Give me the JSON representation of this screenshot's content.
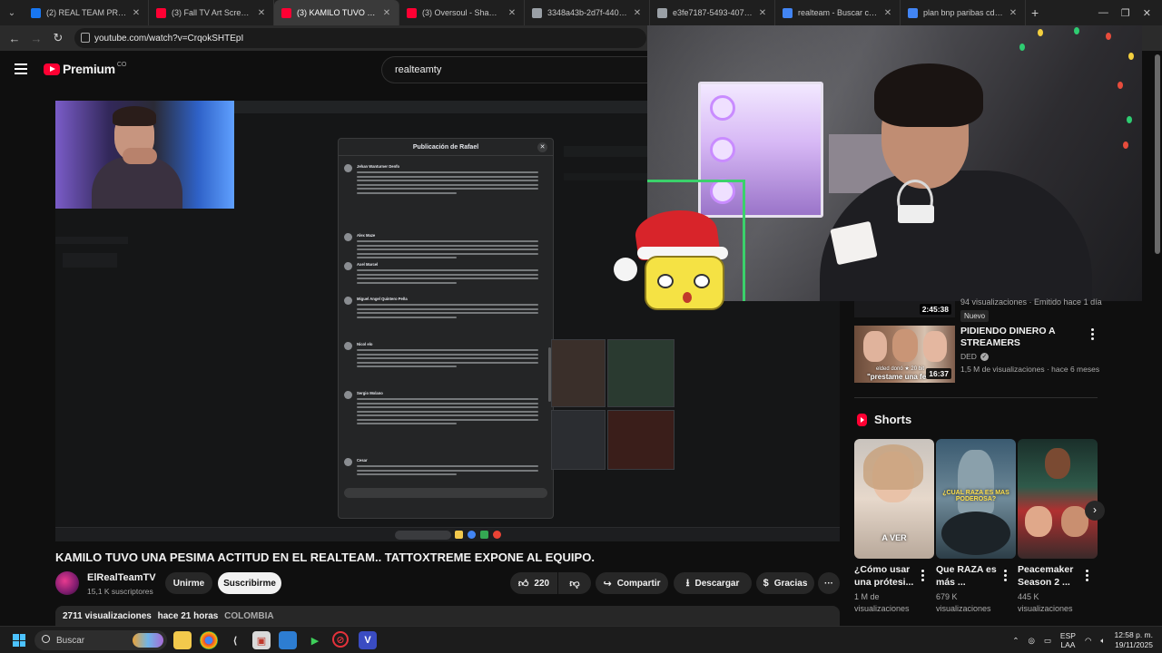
{
  "browser": {
    "tabs": [
      {
        "title": "(2) REAL TEAM PRRASI | F",
        "favicon_color": "#1877f2",
        "active": false
      },
      {
        "title": "(3) Fall TV Art Screensaver",
        "favicon_color": "#ff0033",
        "active": false
      },
      {
        "title": "(3) KAMILO TUVO UNA PE",
        "favicon_color": "#ff0033",
        "active": true
      },
      {
        "title": "(3) Oversoul - Shaman Ki",
        "favicon_color": "#ff0033",
        "active": false
      },
      {
        "title": "3348a43b-2d7f-440a-91b",
        "favicon_color": "#9aa0a6",
        "active": false
      },
      {
        "title": "e3fe7187-5493-4079-a6e",
        "favicon_color": "#9aa0a6",
        "active": false
      },
      {
        "title": "realteam - Buscar con Go",
        "favicon_color": "#4285f4",
        "active": false
      },
      {
        "title": "plan bnp paribas cdf - Bu",
        "favicon_color": "#4285f4",
        "active": false
      }
    ],
    "url": "youtube.com/watch?v=CrqokSHTEpI"
  },
  "youtube": {
    "logo_text": "Premium",
    "logo_sup": "CO",
    "search_query": "realteamty"
  },
  "video": {
    "title": "KAMILO TUVO UNA PESIMA ACTITUD EN EL REALTEAM.. TATTOXTREME EXPONE AL EQUIPO.",
    "channel_name": "ElRealTeamTV",
    "subscribers": "15,1 K suscriptores",
    "join_label": "Unirme",
    "subscribe_label": "Suscribirme",
    "likes": "220",
    "share_label": "Compartir",
    "download_label": "Descargar",
    "thanks_label": "Gracias",
    "views": "2711 visualizaciones",
    "published": "hace 21 horas",
    "hashtag": "COLOMBIA"
  },
  "embedded_screen": {
    "post_title": "Publicación de Rafael",
    "commenters": [
      "Jehan Wanturner Denfo",
      "Alex Maze",
      "Axel Marcel",
      "Miguel Angel Quintero Peña",
      "Nicol elo",
      "Sergio Molano",
      "Cesar"
    ]
  },
  "sidebar": {
    "top_item": {
      "duration": "2:45:38",
      "meta": "94 visualizaciones · Emitido hace 1 día",
      "badge": "Nuevo"
    },
    "recommended": {
      "title": "PIDIENDO DINERO A STREAMERS",
      "channel": "DED",
      "stats": "1,5 M de visualizaciones · hace 6 meses",
      "duration": "16:37",
      "thumb_caption": "\"prestame una fe",
      "thumb_caption_small": "elded donó ★ 20 bit"
    },
    "shorts_heading": "Shorts",
    "shorts": [
      {
        "title": "¿Cómo usar una prótesi...",
        "views": "1 M de visualizaciones",
        "overlay": "A VER"
      },
      {
        "title": "Que RAZA es más ...",
        "views": "679 K visualizaciones",
        "overlay": "¿CUAL RAZA ES MAS PODEROSA?"
      },
      {
        "title": "Peacemaker Season 2 ...",
        "views": "445 K visualizaciones",
        "overlay": ""
      }
    ]
  },
  "taskbar": {
    "search_placeholder": "Buscar",
    "lang_top": "ESP",
    "lang_bottom": "LAA",
    "time": "12:58 p. m.",
    "date": "19/11/2025"
  }
}
